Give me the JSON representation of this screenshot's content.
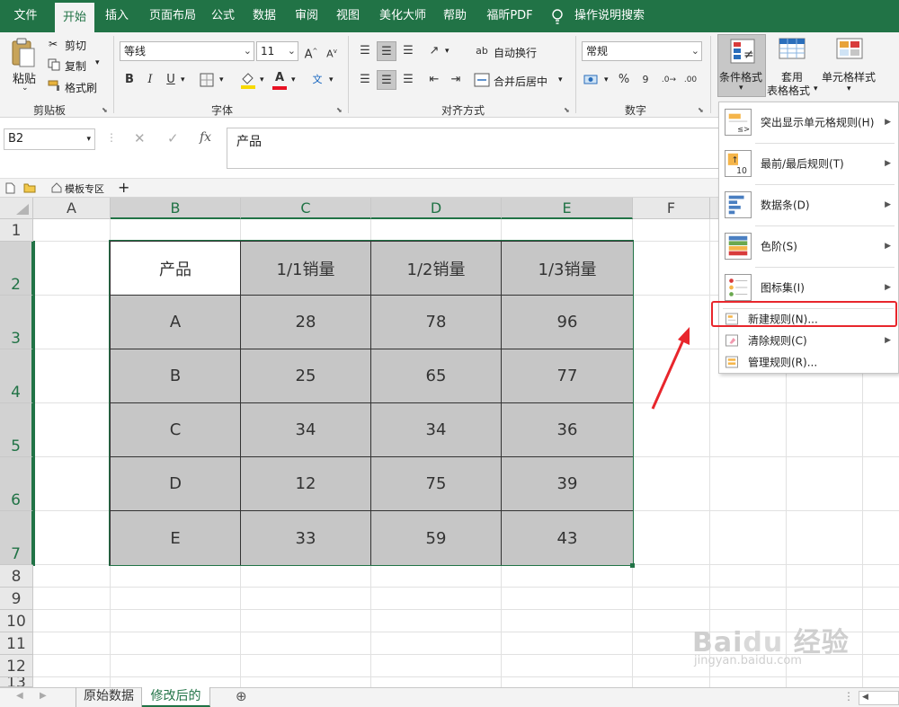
{
  "menubar": {
    "tabs": [
      {
        "label": "文件"
      },
      {
        "label": "开始"
      },
      {
        "label": "插入"
      },
      {
        "label": "页面布局"
      },
      {
        "label": "公式"
      },
      {
        "label": "数据"
      },
      {
        "label": "审阅"
      },
      {
        "label": "视图"
      },
      {
        "label": "美化大师"
      },
      {
        "label": "帮助"
      },
      {
        "label": "福昕PDF"
      }
    ],
    "search_label": "操作说明搜索"
  },
  "ribbon": {
    "clipboard": {
      "paste": "粘贴",
      "cut": "剪切",
      "copy": "复制",
      "format_painter": "格式刷",
      "group_label": "剪贴板"
    },
    "font": {
      "font_name": "等线",
      "font_size": "11",
      "grow": "A",
      "shrink": "A",
      "bold": "B",
      "italic": "I",
      "underline": "U",
      "font_color": "A",
      "phonetic": "文",
      "group_label": "字体"
    },
    "alignment": {
      "wrap_text": "自动换行",
      "merge_center": "合并后居中",
      "group_label": "对齐方式"
    },
    "number": {
      "format": "常规",
      "percent": "%",
      "comma": "9",
      "group_label": "数字"
    },
    "styles": {
      "conditional_formatting": "条件格式",
      "table_format_line1": "套用",
      "table_format_line2": "表格格式",
      "cell_styles": "单元格样式"
    }
  },
  "formula_bar": {
    "name_box": "B2",
    "content": "产品",
    "fx": "fx",
    "cancel": "✕",
    "enter": "✓"
  },
  "doc_tabs": {
    "template_zone": "模板专区",
    "add": "+"
  },
  "grid": {
    "columns": [
      "A",
      "B",
      "C",
      "D",
      "E",
      "F"
    ],
    "rows": [
      "1",
      "2",
      "3",
      "4",
      "5",
      "6",
      "7",
      "8",
      "9",
      "10",
      "11",
      "12",
      "13"
    ],
    "table": {
      "headers": [
        "产品",
        "1/1销量",
        "1/2销量",
        "1/3销量"
      ],
      "rows": [
        [
          "A",
          "28",
          "78",
          "96"
        ],
        [
          "B",
          "25",
          "65",
          "77"
        ],
        [
          "C",
          "34",
          "34",
          "36"
        ],
        [
          "D",
          "12",
          "75",
          "39"
        ],
        [
          "E",
          "33",
          "59",
          "43"
        ]
      ]
    }
  },
  "cf_menu": {
    "items": [
      {
        "label": "突出显示单元格规则(H)"
      },
      {
        "label": "最前/最后规则(T)"
      },
      {
        "label": "数据条(D)"
      },
      {
        "label": "色阶(S)"
      },
      {
        "label": "图标集(I)"
      },
      {
        "label": "新建规则(N)..."
      },
      {
        "label": "清除规则(C)"
      },
      {
        "label": "管理规则(R)..."
      }
    ]
  },
  "sheets": {
    "tabs": [
      {
        "label": "原始数据"
      },
      {
        "label": "修改后的"
      }
    ],
    "add": "+"
  },
  "colors": {
    "brand": "#217346",
    "highlight_box": "#e8262c",
    "cell_fill": "#c6c6c6"
  }
}
